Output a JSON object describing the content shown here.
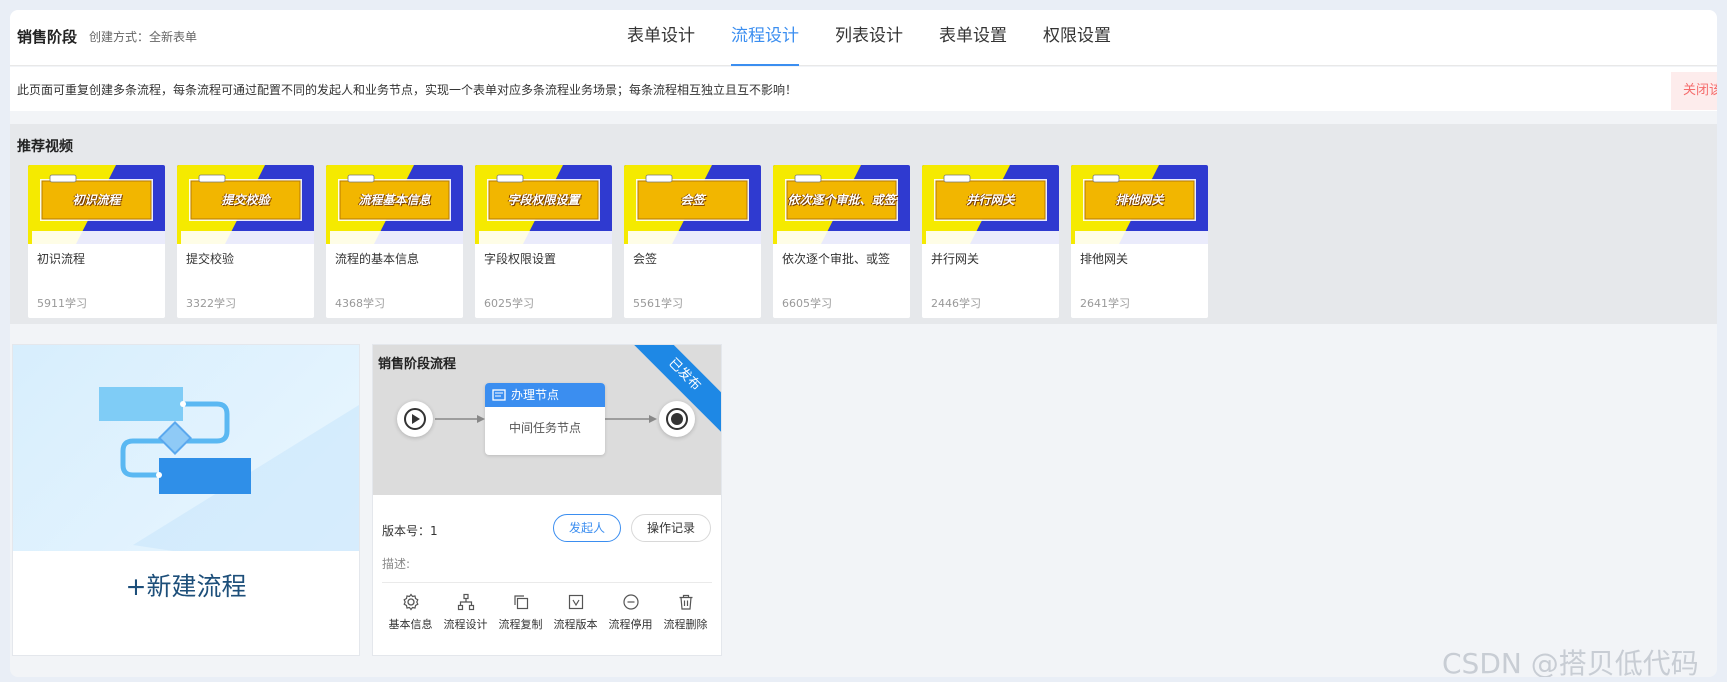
{
  "header": {
    "title": "销售阶段",
    "subtitle": "创建方式：全新表单",
    "tabs": [
      {
        "label": "表单设计",
        "active": false
      },
      {
        "label": "流程设计",
        "active": true
      },
      {
        "label": "列表设计",
        "active": false
      },
      {
        "label": "表单设置",
        "active": false
      },
      {
        "label": "权限设置",
        "active": false
      }
    ]
  },
  "notice": {
    "text": "此页面可重复创建多条流程，每条流程可通过配置不同的发起人和业务节点，实现一个表单对应多条流程业务场景；每条流程相互独立且互不影响！",
    "close_label": "关闭该"
  },
  "recommended": {
    "title": "推荐视频",
    "videos": [
      {
        "thumb": "初识流程",
        "name": "初识流程",
        "count": "5911学习"
      },
      {
        "thumb": "提交校验",
        "name": "提交校验",
        "count": "3322学习"
      },
      {
        "thumb": "流程基本信息",
        "name": "流程的基本信息",
        "count": "4368学习"
      },
      {
        "thumb": "字段权限设置",
        "name": "字段权限设置",
        "count": "6025学习"
      },
      {
        "thumb": "会签",
        "name": "会签",
        "count": "5561学习"
      },
      {
        "thumb": "依次逐个审批、或签",
        "name": "依次逐个审批、或签",
        "count": "6605学习"
      },
      {
        "thumb": "并行网关",
        "name": "并行网关",
        "count": "2446学习"
      },
      {
        "thumb": "排他网关",
        "name": "排他网关",
        "count": "2641学习"
      }
    ]
  },
  "new_flow": {
    "label": "+新建流程"
  },
  "flow_card": {
    "title": "销售阶段流程",
    "status": "已发布",
    "node_title": "办理节点",
    "node_body": "中间任务节点",
    "version_label": "版本号：",
    "version": "1",
    "starter_button": "发起人",
    "log_button": "操作记录",
    "description_label": "描述:",
    "actions": [
      {
        "icon": "gear-icon",
        "label": "基本信息"
      },
      {
        "icon": "flow-tree-icon",
        "label": "流程设计"
      },
      {
        "icon": "copy-icon",
        "label": "流程复制"
      },
      {
        "icon": "version-icon",
        "label": "流程版本"
      },
      {
        "icon": "minus-circle-icon",
        "label": "流程停用"
      },
      {
        "icon": "trash-icon",
        "label": "流程删除"
      }
    ]
  },
  "watermark": "CSDN @搭贝低代码",
  "colors": {
    "accent": "#3b8ef0",
    "ribbon": "#1e88e5",
    "thumb_yellow": "#f2b600",
    "thumb_blue": "#2f3ad0"
  }
}
